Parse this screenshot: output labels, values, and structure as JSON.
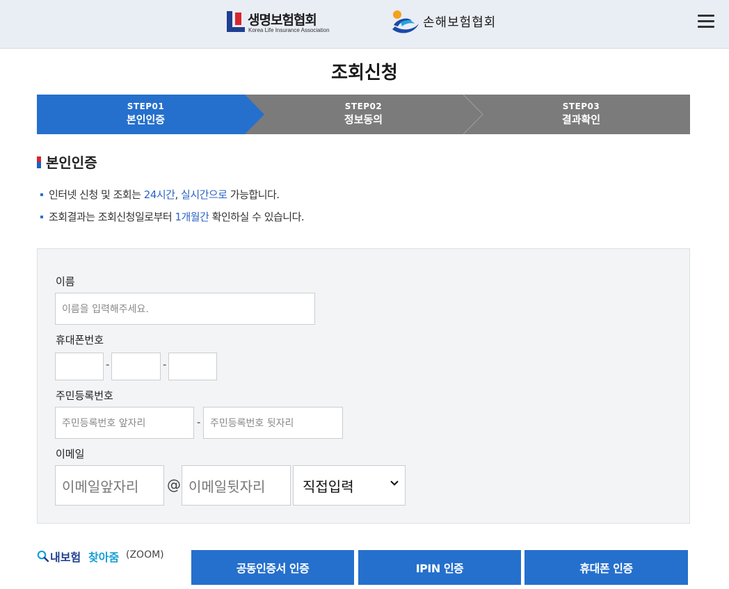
{
  "header": {
    "logo1_name": "생명보험협회",
    "logo1_sub": "Korea Life Insurance Association",
    "logo2_name": "손해보험협회",
    "menu_icon": "hamburger-menu-icon"
  },
  "page": {
    "title": "조회신청"
  },
  "steps": [
    {
      "num": "STEP01",
      "label": "본인인증",
      "active": true
    },
    {
      "num": "STEP02",
      "label": "정보동의",
      "active": false
    },
    {
      "num": "STEP03",
      "label": "결과확인",
      "active": false
    }
  ],
  "colors": {
    "step_active": "#2570cc",
    "step_inactive": "#7b7b7b",
    "accent": "#2a64c4",
    "button": "#2570cc"
  },
  "section": {
    "title": "본인인증"
  },
  "notes": [
    {
      "parts": [
        "인터넷 신청 및 조회는 ",
        "24시간",
        ", ",
        "실시간으로",
        " 가능합니다."
      ]
    },
    {
      "parts": [
        "조회결과는 조회신청일로부터 ",
        "1개월간",
        " 확인하실 수 있습니다."
      ]
    }
  ],
  "form": {
    "name_label": "이름",
    "name_placeholder": "이름을 입력해주세요.",
    "phone_label": "휴대폰번호",
    "phone_sep": "-",
    "ssn_label": "주민등록번호",
    "ssn_front_placeholder": "주민등록번호 앞자리",
    "ssn_back_placeholder": "주민등록번호 뒷자리",
    "ssn_sep": "-",
    "email_label": "이메일",
    "email_front_placeholder": "이메일앞자리",
    "email_at": "@",
    "email_back_placeholder": "이메일뒷자리",
    "email_domain_selected": "직접입력"
  },
  "zoom": {
    "part1": "내보험",
    "part2": "찾아줌",
    "part3": "(ZOOM)"
  },
  "buttons": {
    "cert": "공동인증서 인증",
    "ipin": "IPIN 인증",
    "phone": "휴대폰 인증"
  }
}
